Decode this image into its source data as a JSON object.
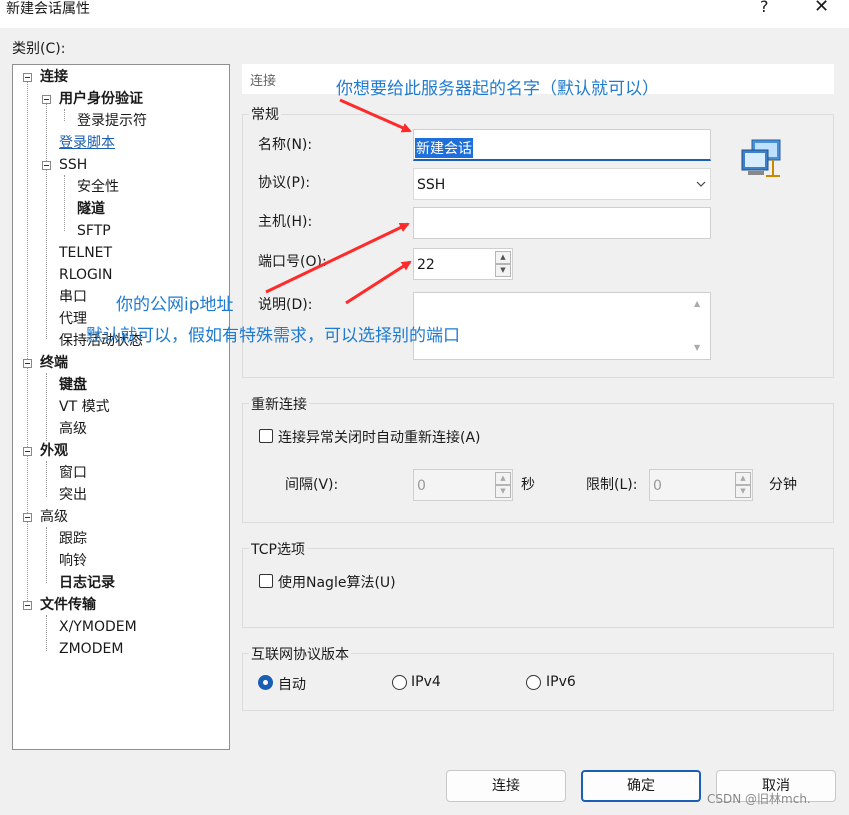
{
  "window": {
    "title": "新建会话属性",
    "help_glyph": "?",
    "close_glyph": "✕"
  },
  "category_label": "类别(C):",
  "tree": {
    "items": [
      {
        "label": "连接"
      },
      {
        "label": "用户身份验证"
      },
      {
        "label": "登录提示符"
      },
      {
        "label": "登录脚本"
      },
      {
        "label": "SSH"
      },
      {
        "label": "安全性"
      },
      {
        "label": "隧道"
      },
      {
        "label": "SFTP"
      },
      {
        "label": "TELNET"
      },
      {
        "label": "RLOGIN"
      },
      {
        "label": "串口"
      },
      {
        "label": "代理"
      },
      {
        "label": "保持活动状态"
      },
      {
        "label": "终端"
      },
      {
        "label": "键盘"
      },
      {
        "label": "VT 模式"
      },
      {
        "label": "高级"
      },
      {
        "label": "外观"
      },
      {
        "label": "窗口"
      },
      {
        "label": "突出"
      },
      {
        "label": "高级"
      },
      {
        "label": "跟踪"
      },
      {
        "label": "响铃"
      },
      {
        "label": "日志记录"
      },
      {
        "label": "文件传输"
      },
      {
        "label": "X/YMODEM"
      },
      {
        "label": "ZMODEM"
      }
    ]
  },
  "panel": {
    "header": "连接",
    "general": {
      "title": "常规",
      "name_label": "名称(N):",
      "name_value": "新建会话",
      "protocol_label": "协议(P):",
      "protocol_value": "SSH",
      "host_label": "主机(H):",
      "host_value": "",
      "port_label": "端口号(O):",
      "port_value": "22",
      "desc_label": "说明(D):",
      "desc_value": ""
    },
    "reconnect": {
      "title": "重新连接",
      "checkbox_label": "连接异常关闭时自动重新连接(A)",
      "interval_label": "间隔(V):",
      "interval_value": "0",
      "interval_unit": "秒",
      "limit_label": "限制(L):",
      "limit_value": "0",
      "limit_unit": "分钟"
    },
    "tcp": {
      "title": "TCP选项",
      "nagle_label": "使用Nagle算法(U)"
    },
    "ip": {
      "title": "互联网协议版本",
      "auto": "自动",
      "ipv4": "IPv4",
      "ipv6": "IPv6",
      "selected": "自动"
    }
  },
  "buttons": {
    "connect": "连接",
    "ok": "确定",
    "cancel": "取消"
  },
  "annotations": {
    "name_hint": "你想要给此服务器起的名字（默认就可以）",
    "host_hint": "你的公网ip地址",
    "port_hint": "默认就可以，假如有特殊需求，可以选择别的端口",
    "color": "#1e7bd1",
    "arrow_color": "#ff2a2a"
  },
  "watermark": "CSDN @旧林mch."
}
